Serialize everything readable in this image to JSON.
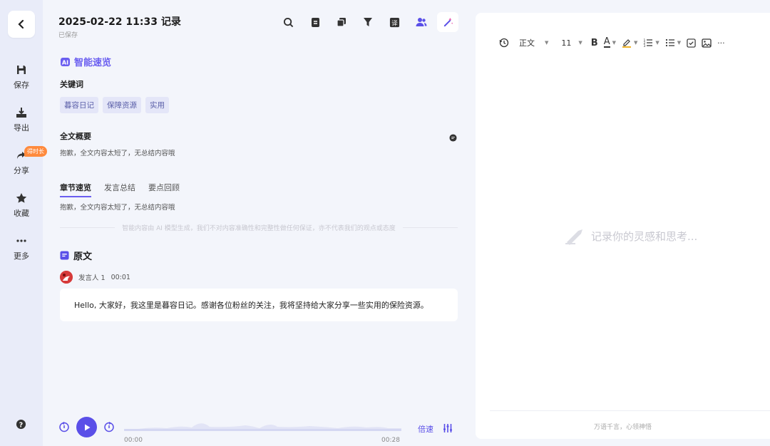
{
  "sidebar": {
    "items": [
      {
        "label": "保存",
        "icon": "save-icon"
      },
      {
        "label": "导出",
        "icon": "export-icon"
      },
      {
        "label": "分享",
        "icon": "share-icon",
        "badge": "得时长"
      },
      {
        "label": "收藏",
        "icon": "star-icon"
      },
      {
        "label": "更多",
        "icon": "more-icon"
      }
    ]
  },
  "header": {
    "title": "2025-02-22 11:33 记录",
    "saved_status": "已保存"
  },
  "ai_overview": {
    "title": "智能速览",
    "keywords_label": "关键词",
    "keywords": [
      "暮容日记",
      "保障资源",
      "实用"
    ],
    "summary_label": "全文概要",
    "summary_text": "抱歉，全文内容太短了，无总结内容哦",
    "tabs": [
      "章节速览",
      "发言总结",
      "要点回顾"
    ],
    "tab_text": "抱歉，全文内容太短了，无总结内容哦",
    "disclaimer": "智能内容由 AI 模型生成，我们不对内容准确性和完整性做任何保证，亦不代表我们的观点或态度"
  },
  "transcript": {
    "title": "原文",
    "speaker": "发言人 1",
    "timestamp": "00:01",
    "text": "Hello, 大家好，我这里是暮容日记。感谢各位粉丝的关注，我将坚持给大家分享一些实用的保险资源。"
  },
  "player": {
    "current_time": "00:00",
    "total_time": "00:28",
    "speed_label": "倍速",
    "progress": 0
  },
  "editor": {
    "toolbar": {
      "style": "正文",
      "font_size": "11",
      "bold": "B",
      "font_color": "A",
      "more": "···"
    },
    "placeholder": "记录你的灵感和思考...",
    "footer": "万语千言，心领神悟"
  },
  "colors": {
    "accent": "#5a4fe8",
    "badge": "#ff8a3d"
  }
}
